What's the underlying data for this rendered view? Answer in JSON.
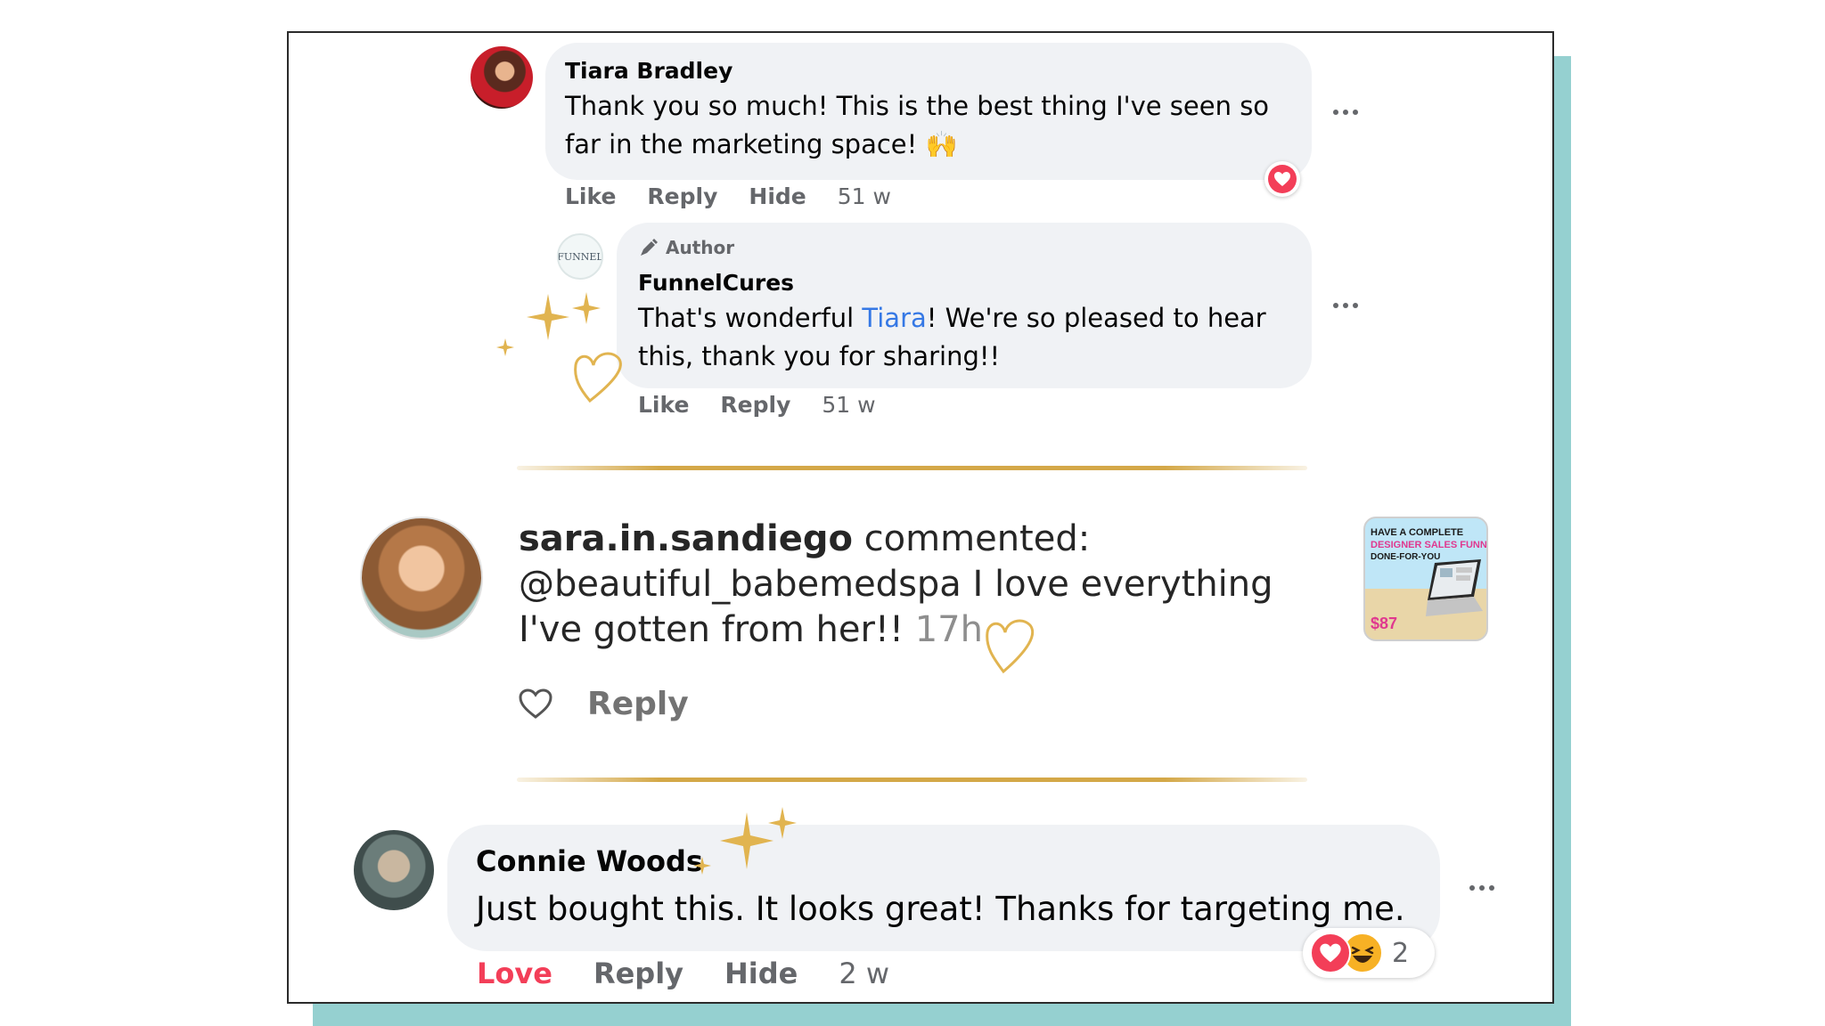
{
  "comment1": {
    "name": "Tiara Bradley",
    "text_line1": "Thank you so much! This is the best thing I've seen so",
    "text_line2": "far in the marketing space! 🙌",
    "actions": {
      "like": "Like",
      "reply": "Reply",
      "hide": "Hide",
      "time": "51 w"
    },
    "reaction_icon": "heart-reaction-icon"
  },
  "reply1": {
    "badge": "Author",
    "avatar_text": "FUNNEL",
    "name": "FunnelCures",
    "text_before_mention": "That's wonderful ",
    "mention": "Tiara",
    "text_after_mention": "! We're so pleased to hear",
    "text_line2": "this, thank you for sharing!!",
    "actions": {
      "like": "Like",
      "reply": "Reply",
      "time": "51 w"
    }
  },
  "instagram_comment": {
    "username": "sara.in.sandiego",
    "verb": " commented:",
    "line2": "@beautiful_babemedspa I love everything",
    "line3": "I've gotten from her!!",
    "time": "17h",
    "reply": "Reply",
    "thumbnail": {
      "line1": "HAVE A COMPLETE",
      "line2": "DESIGNER SALES FUNNEL",
      "line3": "DONE-FOR-YOU",
      "price": "$87"
    }
  },
  "comment2": {
    "name": "Connie Woods",
    "text": "Just bought this. It looks great! Thanks for targeting me.",
    "actions": {
      "love": "Love",
      "reply": "Reply",
      "hide": "Hide",
      "time": "2 w"
    },
    "reaction_count": "2"
  },
  "colors": {
    "shadow": "#95d0d0",
    "bubble": "#f0f2f5",
    "gold": "#d4a848",
    "love_red": "#f33e58",
    "mention_blue": "#3578e5",
    "secondary_text": "#65676b"
  }
}
